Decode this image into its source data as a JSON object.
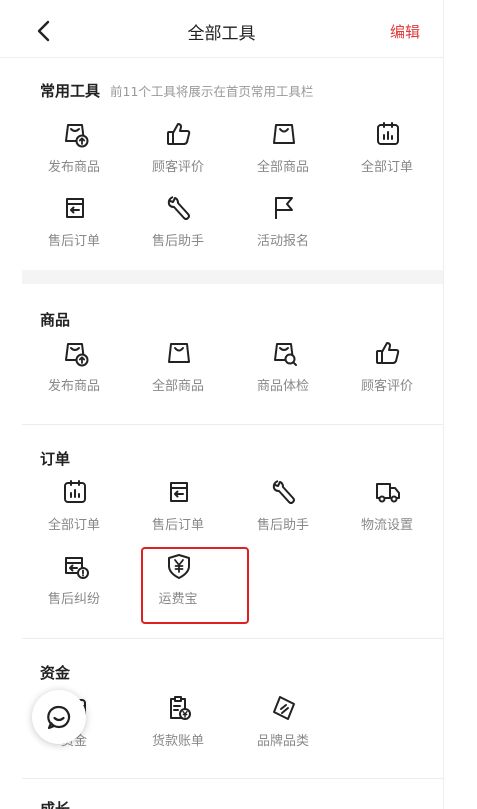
{
  "navbar": {
    "title": "全部工具",
    "edit_label": "编辑",
    "accent_color": "#e23a3a"
  },
  "common": {
    "title": "常用工具",
    "subtitle": "前11个工具将展示在首页常用工具栏",
    "items": [
      {
        "label": "发布商品",
        "icon": "bag-upload-icon"
      },
      {
        "label": "顾客评价",
        "icon": "thumbs-up-icon"
      },
      {
        "label": "全部商品",
        "icon": "shopping-bag-icon"
      },
      {
        "label": "全部订单",
        "icon": "clipboard-chart-icon"
      },
      {
        "label": "售后订单",
        "icon": "return-box-icon"
      },
      {
        "label": "售后助手",
        "icon": "wrench-icon"
      },
      {
        "label": "活动报名",
        "icon": "flag-icon"
      }
    ]
  },
  "goods": {
    "title": "商品",
    "items": [
      {
        "label": "发布商品",
        "icon": "bag-upload-icon"
      },
      {
        "label": "全部商品",
        "icon": "shopping-bag-icon"
      },
      {
        "label": "商品体检",
        "icon": "bag-search-icon"
      },
      {
        "label": "顾客评价",
        "icon": "thumbs-up-icon"
      }
    ]
  },
  "orders": {
    "title": "订单",
    "items": [
      {
        "label": "全部订单",
        "icon": "clipboard-chart-icon"
      },
      {
        "label": "售后订单",
        "icon": "return-box-icon"
      },
      {
        "label": "售后助手",
        "icon": "wrench-icon"
      },
      {
        "label": "物流设置",
        "icon": "truck-icon"
      },
      {
        "label": "售后纠纷",
        "icon": "dispute-box-icon"
      },
      {
        "label": "运费宝",
        "icon": "yen-shield-icon"
      }
    ]
  },
  "funds": {
    "title": "资金",
    "items": [
      {
        "label": "资金",
        "icon": "wallet-icon"
      },
      {
        "label": "货款账单",
        "icon": "bill-icon"
      },
      {
        "label": "品牌品类",
        "icon": "tag-icon"
      }
    ]
  },
  "growth": {
    "title": "成长"
  },
  "floating": {
    "icon": "chat-icon"
  }
}
